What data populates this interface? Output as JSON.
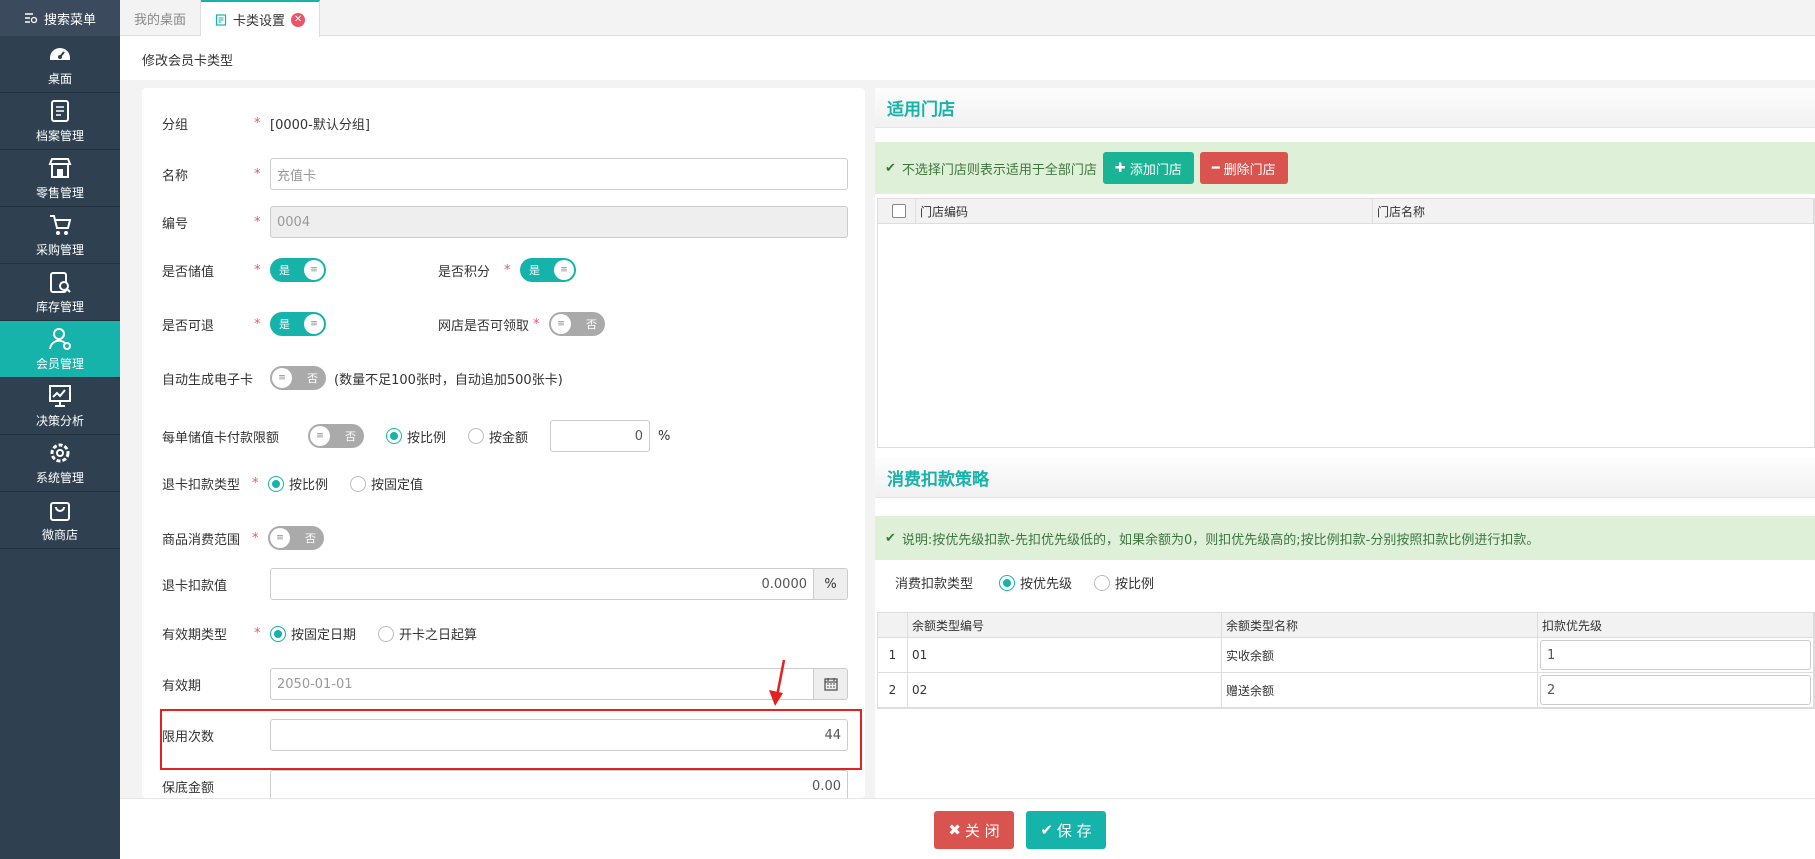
{
  "sidebar": {
    "search_label": "搜索菜单",
    "items": [
      {
        "label": "桌面",
        "icon": "dashboard-icon"
      },
      {
        "label": "档案管理",
        "icon": "archive-icon"
      },
      {
        "label": "零售管理",
        "icon": "store-icon"
      },
      {
        "label": "采购管理",
        "icon": "cart-icon"
      },
      {
        "label": "库存管理",
        "icon": "inventory-icon"
      },
      {
        "label": "会员管理",
        "icon": "member-icon"
      },
      {
        "label": "决策分析",
        "icon": "chart-icon"
      },
      {
        "label": "系统管理",
        "icon": "gear-icon"
      },
      {
        "label": "微商店",
        "icon": "bag-icon"
      }
    ]
  },
  "tabs": [
    {
      "label": "我的桌面"
    },
    {
      "label": "卡类设置"
    }
  ],
  "page": {
    "subtitle": "修改会员卡类型"
  },
  "form": {
    "group_label": "分组",
    "group_value": "[0000-默认分组]",
    "name_label": "名称",
    "name_placeholder": "充值卡",
    "code_label": "编号",
    "code_value": "0004",
    "stored_value_label": "是否储值",
    "stored_value_state": "是",
    "points_label": "是否积分",
    "points_state": "是",
    "refundable_label": "是否可退",
    "refundable_state": "是",
    "online_claim_label": "网店是否可领取",
    "online_claim_state": "否",
    "auto_ecard_label": "自动生成电子卡",
    "auto_ecard_state": "否",
    "auto_ecard_note": "(数量不足100张时，自动追加500张卡)",
    "pay_limit_label": "每单储值卡付款限额",
    "pay_limit_state": "否",
    "pay_limit_opt1": "按比例",
    "pay_limit_opt2": "按金额",
    "pay_limit_value": "0",
    "pay_limit_unit": "%",
    "refund_type_label": "退卡扣款类型",
    "refund_type_opt1": "按比例",
    "refund_type_opt2": "按固定值",
    "goods_scope_label": "商品消费范围",
    "goods_scope_state": "否",
    "refund_value_label": "退卡扣款值",
    "refund_value": "0.0000",
    "refund_value_unit": "%",
    "validity_type_label": "有效期类型",
    "validity_opt1": "按固定日期",
    "validity_opt2": "开卡之日起算",
    "validity_label": "有效期",
    "validity_value": "2050-01-01",
    "limit_times_label": "限用次数",
    "limit_times_value": "44",
    "min_amount_label": "保底金额",
    "min_amount_value": "0.00"
  },
  "stores": {
    "title": "适用门店",
    "notice": "不选择门店则表示适用于全部门店",
    "add_label": "添加门店",
    "delete_label": "删除门店",
    "columns": [
      "门店编码",
      "门店名称"
    ]
  },
  "strategy": {
    "title": "消费扣款策略",
    "notice": "说明:按优先级扣款-先扣优先级低的，如果余额为0，则扣优先级高的;按比例扣款-分别按照扣款比例进行扣款。",
    "type_label": "消费扣款类型",
    "opt1": "按优先级",
    "opt2": "按比例",
    "columns": [
      "余额类型编号",
      "余额类型名称",
      "扣款优先级"
    ],
    "rows": [
      {
        "idx": "1",
        "code": "01",
        "name": "实收余额",
        "priority": "1"
      },
      {
        "idx": "2",
        "code": "02",
        "name": "赠送余额",
        "priority": "2"
      }
    ]
  },
  "footer": {
    "close_label": "关 闭",
    "save_label": "保 存"
  },
  "colors": {
    "accent": "#15b3aa",
    "sidebar": "#2f4050",
    "danger": "#d9534f",
    "highlight": "#e5201f"
  }
}
